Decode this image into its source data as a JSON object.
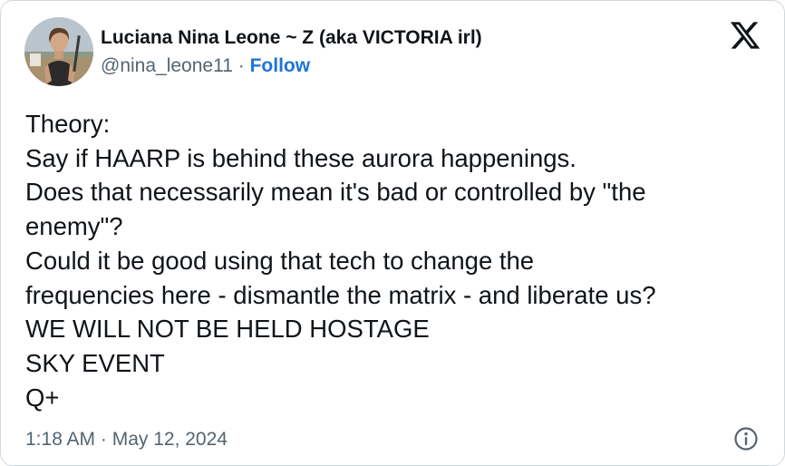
{
  "author": {
    "display_name": "Luciana Nina Leone ~ Z (aka VICTORIA irl)",
    "handle": "@nina_leone11",
    "separator": "·",
    "follow_label": "Follow",
    "avatar_icon": "profile-photo"
  },
  "platform_icon": "x-logo-icon",
  "tweet": {
    "lines": [
      "Theory:",
      "Say if HAARP is behind these aurora happenings.",
      "Does that necessarily mean it's bad or controlled by \"the",
      "enemy\"?",
      "Could it be good using that tech to change the",
      "frequencies here - dismantle the matrix - and liberate us?",
      "WE WILL NOT BE HELD HOSTAGE",
      "SKY EVENT",
      "Q+"
    ]
  },
  "footer": {
    "timestamp": "1:18 AM · May 12, 2024",
    "info_icon": "info-icon"
  },
  "colors": {
    "text": "#0f1419",
    "secondary": "#536471",
    "link": "#1d74d8",
    "border": "#cfd9de"
  }
}
